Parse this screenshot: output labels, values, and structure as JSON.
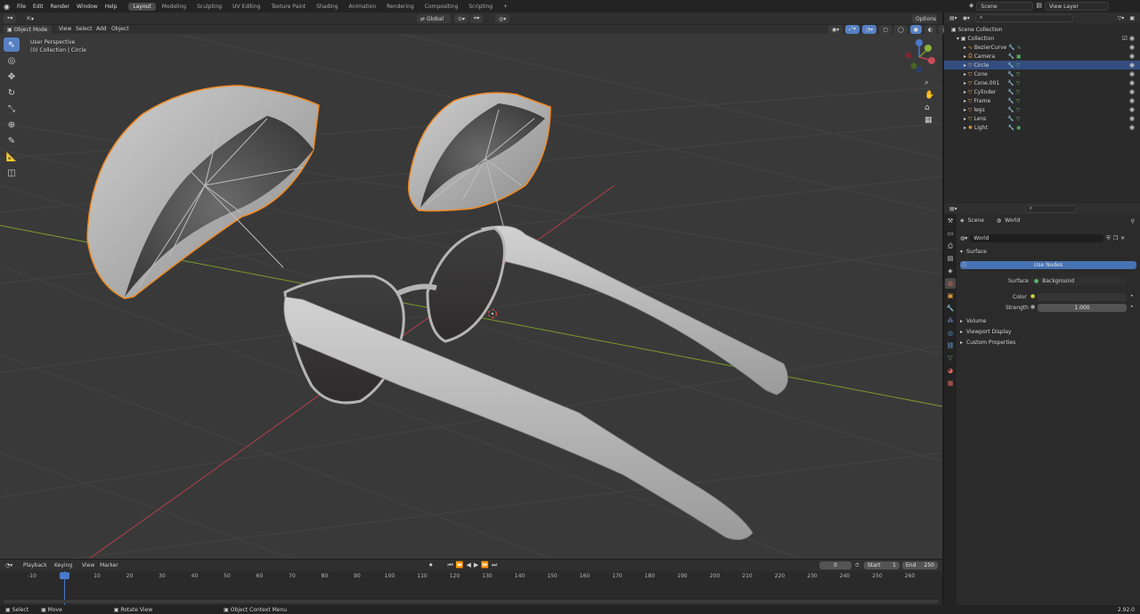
{
  "menu": [
    "File",
    "Edit",
    "Render",
    "Window",
    "Help"
  ],
  "workspaces": [
    {
      "label": "Layout",
      "active": true
    },
    {
      "label": "Modeling"
    },
    {
      "label": "Sculpting"
    },
    {
      "label": "UV Editing"
    },
    {
      "label": "Texture Paint"
    },
    {
      "label": "Shading"
    },
    {
      "label": "Animation"
    },
    {
      "label": "Rendering"
    },
    {
      "label": "Compositing"
    },
    {
      "label": "Scripting"
    },
    {
      "label": "+"
    }
  ],
  "scene_name": "Scene",
  "view_layer": "View Layer",
  "viewport": {
    "mode": "Object Mode",
    "menus": [
      "View",
      "Select",
      "Add",
      "Object"
    ],
    "transform_orientation": "Global",
    "options": "Options",
    "perspective": "User Perspective",
    "collection_info": "(0) Collection | Circle"
  },
  "outliner": {
    "root": "Scene Collection",
    "collection": "Collection",
    "items": [
      {
        "label": "BezierCurve"
      },
      {
        "label": "Camera"
      },
      {
        "label": "Circle",
        "selected": true
      },
      {
        "label": "Cone"
      },
      {
        "label": "Cone.001"
      },
      {
        "label": "Cylinder"
      },
      {
        "label": "Frame"
      },
      {
        "label": "legs"
      },
      {
        "label": "Lens"
      },
      {
        "label": "Light"
      }
    ]
  },
  "properties": {
    "breadcrumb_scene": "Scene",
    "breadcrumb_world": "World",
    "world_name": "World",
    "surface_panel": "Surface",
    "use_nodes": "Use Nodes",
    "surface_label": "Surface",
    "surface_value": "Background",
    "color_label": "Color",
    "strength_label": "Strength",
    "strength_value": "1.000",
    "panels": [
      "Volume",
      "Viewport Display",
      "Custom Properties"
    ]
  },
  "timeline": {
    "menus": [
      "Playback",
      "Keying",
      "View",
      "Marker"
    ],
    "current_frame": "0",
    "start_label": "Start",
    "start_value": "1",
    "end_label": "End",
    "end_value": "250",
    "ticks": [
      "-10",
      "0",
      "10",
      "20",
      "30",
      "40",
      "50",
      "60",
      "70",
      "80",
      "90",
      "100",
      "110",
      "120",
      "130",
      "140",
      "150",
      "160",
      "170",
      "180",
      "190",
      "200",
      "210",
      "220",
      "230",
      "240",
      "250",
      "260"
    ]
  },
  "status": {
    "select": "Select",
    "move": "Move",
    "rotate": "Rotate View",
    "context": "Object Context Menu",
    "version": "2.92.0"
  },
  "colors": {
    "accent": "#5680c2",
    "selection_outline": "#f08a24",
    "x_axis": "#b3404a",
    "y_axis": "#7a9a2a"
  }
}
